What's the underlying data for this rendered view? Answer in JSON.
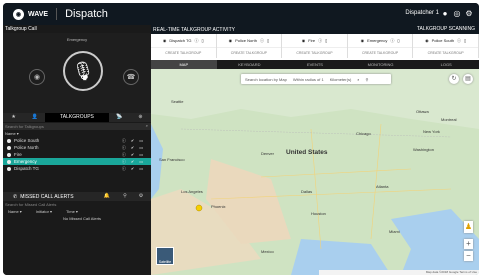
{
  "app": {
    "brand": "WAVE",
    "title": "Dispatch",
    "user": "Dispatcher 1"
  },
  "left": {
    "header": "Talkgroup Call",
    "emergency_label": "Emergency",
    "tabs": [
      "★",
      "👤",
      "TALKGROUPS",
      "📡",
      "⊕"
    ],
    "search_placeholder": "Search for Talkgroups",
    "name_header": "Name ▾",
    "talkgroups": [
      {
        "name": "Police South"
      },
      {
        "name": "Police North"
      },
      {
        "name": "Fire"
      },
      {
        "name": "Emergency"
      },
      {
        "name": "Dispatch TG"
      }
    ],
    "missed": {
      "title": "MISSED CALL ALERTS",
      "search_placeholder": "Search for Missed Call Alerts",
      "cols": [
        "Name ▾",
        "Initiator ▾",
        "Time ▾"
      ],
      "empty": "No Missed Call Alerts"
    }
  },
  "right": {
    "activity_title": "REAL-TIME TALKGROUP ACTIVITY",
    "scanning": "TALKGROUP SCANNING",
    "channels": [
      {
        "name": "Dispatch TG",
        "btn": "CREATE TALKGROUP"
      },
      {
        "name": "Police North",
        "btn": "CREATE TALKGROUP"
      },
      {
        "name": "Fire",
        "btn": "CREATE TALKGROUP"
      },
      {
        "name": "Emergency",
        "btn": "CREATE TALKGROUP"
      },
      {
        "name": "Police South",
        "btn": "CREATE TALKGROUP"
      }
    ],
    "map_tabs": [
      "MAP",
      "KEYBOARD",
      "EVENTS",
      "MONITORING",
      "LOGS"
    ],
    "map": {
      "search_placeholder": "Search location by Map",
      "radius": "Within radius of 1",
      "unit": "Kilometer(s)",
      "country": "United States",
      "cities": [
        "Chicago",
        "New York",
        "Washington",
        "Denver",
        "Los Angeles",
        "San Francisco",
        "Phoenix",
        "Houston",
        "Dallas",
        "Atlanta",
        "Miami",
        "Seattle",
        "Mexico",
        "Ottawa",
        "Montreal"
      ],
      "satellite": "Satellite",
      "footer": "Map data ©2018 Google  Terms of Use"
    }
  }
}
